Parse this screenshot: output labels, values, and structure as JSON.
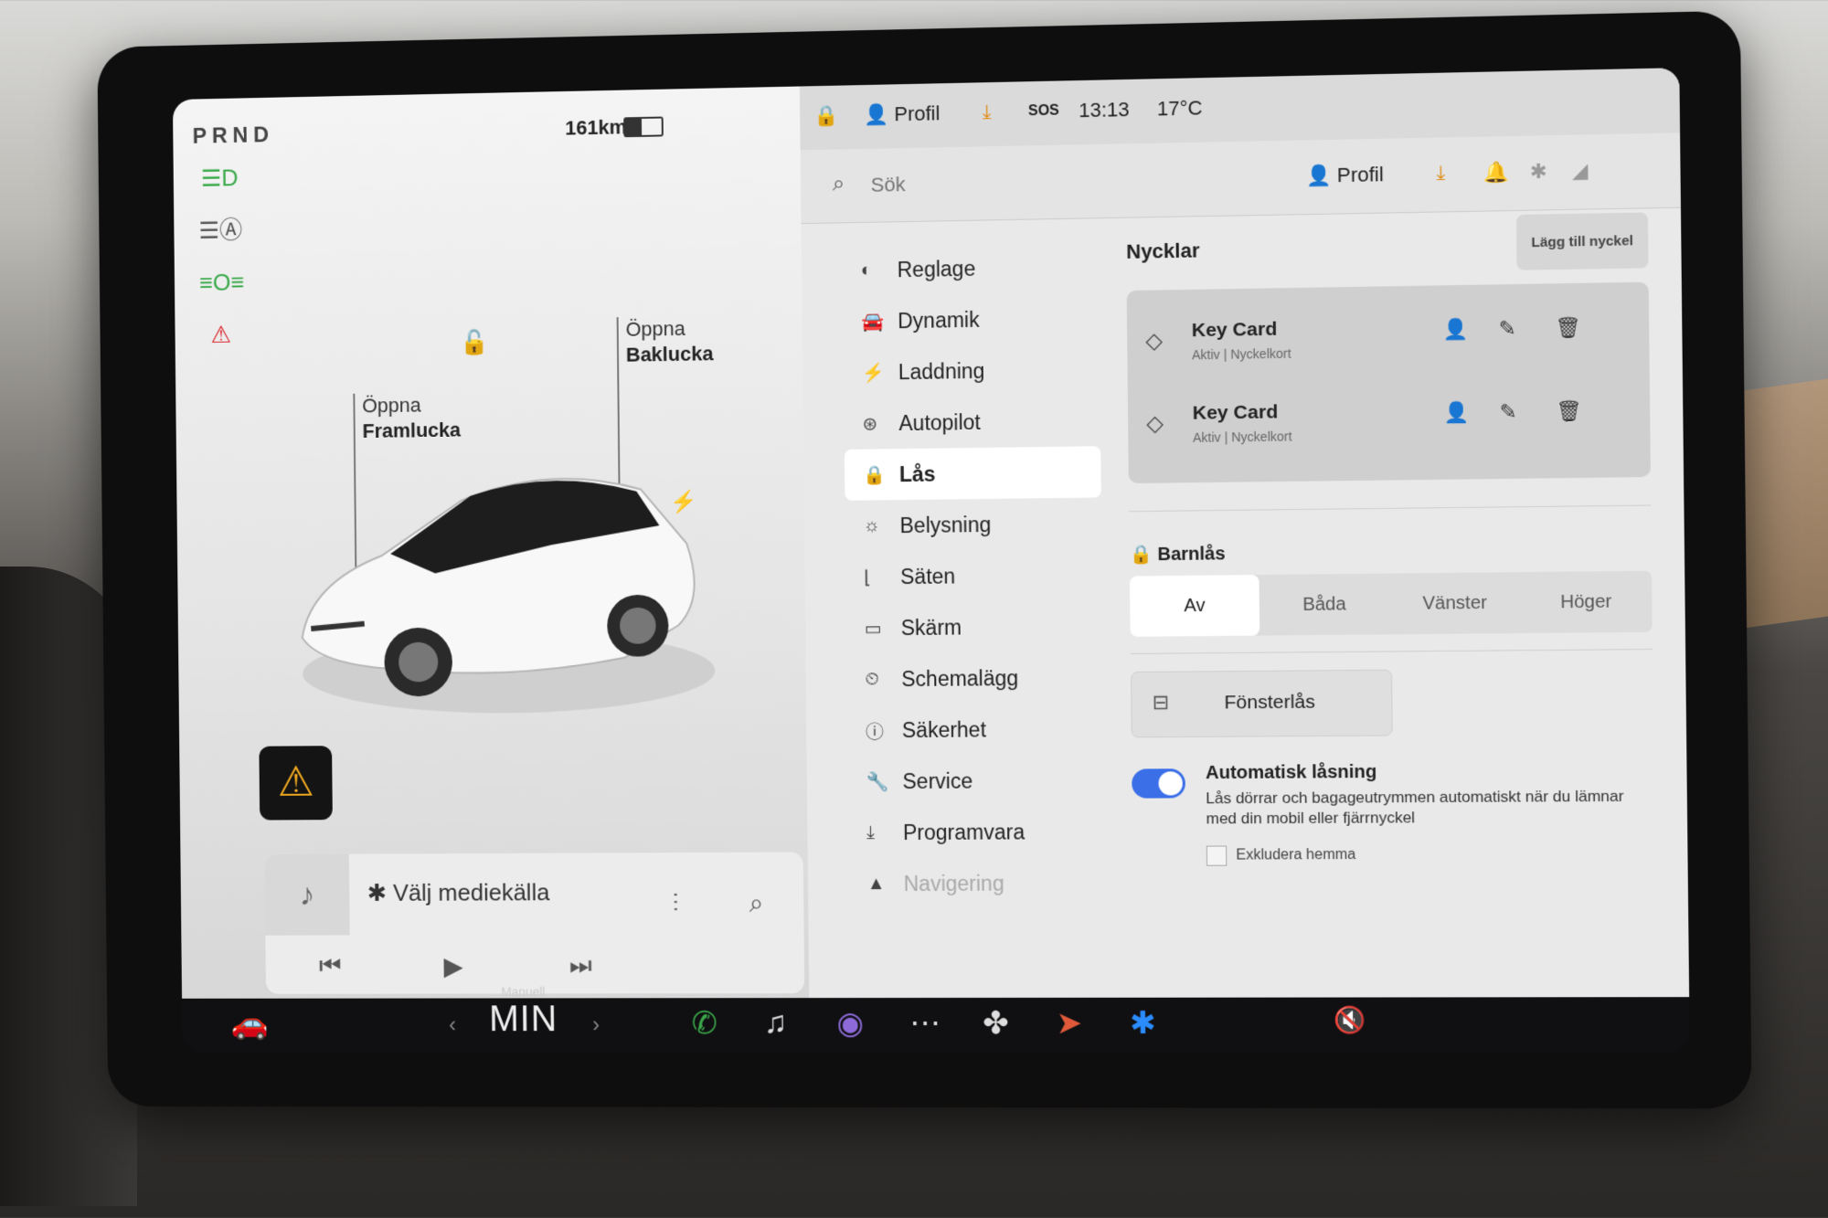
{
  "status": {
    "gear": "PRND",
    "range": "161km",
    "battery_level_pct": 45
  },
  "car": {
    "front_trunk_label": "Öppna",
    "front_trunk_name": "Framlucka",
    "rear_trunk_label": "Öppna",
    "rear_trunk_name": "Baklucka"
  },
  "media": {
    "source": "Välj mediekälla"
  },
  "topbar": {
    "profile": "Profil",
    "sos": "SOS",
    "time": "13:13",
    "temp": "17°C"
  },
  "search": {
    "placeholder": "Sök",
    "profile": "Profil"
  },
  "menu": [
    {
      "label": "Reglage",
      "icon": "toggle-icon"
    },
    {
      "label": "Dynamik",
      "icon": "car-icon"
    },
    {
      "label": "Laddning",
      "icon": "bolt-icon"
    },
    {
      "label": "Autopilot",
      "icon": "steering-wheel-icon"
    },
    {
      "label": "Lås",
      "icon": "lock-icon"
    },
    {
      "label": "Belysning",
      "icon": "light-icon"
    },
    {
      "label": "Säten",
      "icon": "seat-icon"
    },
    {
      "label": "Skärm",
      "icon": "display-icon"
    },
    {
      "label": "Schemalägg",
      "icon": "clock-icon"
    },
    {
      "label": "Säkerhet",
      "icon": "info-icon"
    },
    {
      "label": "Service",
      "icon": "wrench-icon"
    },
    {
      "label": "Programvara",
      "icon": "download-icon"
    },
    {
      "label": "Navigering",
      "icon": "navigation-icon"
    }
  ],
  "keys": {
    "title": "Nycklar",
    "add_button": "Lägg till nyckel",
    "items": [
      {
        "name": "Key Card",
        "status": "Aktiv | Nyckelkort"
      },
      {
        "name": "Key Card",
        "status": "Aktiv | Nyckelkort"
      }
    ]
  },
  "child_lock": {
    "label": "Barnlås",
    "options": [
      "Av",
      "Båda",
      "Vänster",
      "Höger"
    ],
    "selected": "Av"
  },
  "window_lock": {
    "label": "Fönsterlås"
  },
  "auto_lock": {
    "title": "Automatisk låsning",
    "description": "Lås dörrar och bagageutrymmen automatiskt när du lämnar med din mobil eller fjärrnyckel",
    "enabled": true,
    "exclude_label": "Exkludera hemma"
  },
  "bottom": {
    "mode": "Manuell",
    "fan": "MIN"
  },
  "colors": {
    "accent": "#3b6fe8",
    "warning": "#f0a920",
    "green": "#3aa94a",
    "red": "#d9262c"
  }
}
